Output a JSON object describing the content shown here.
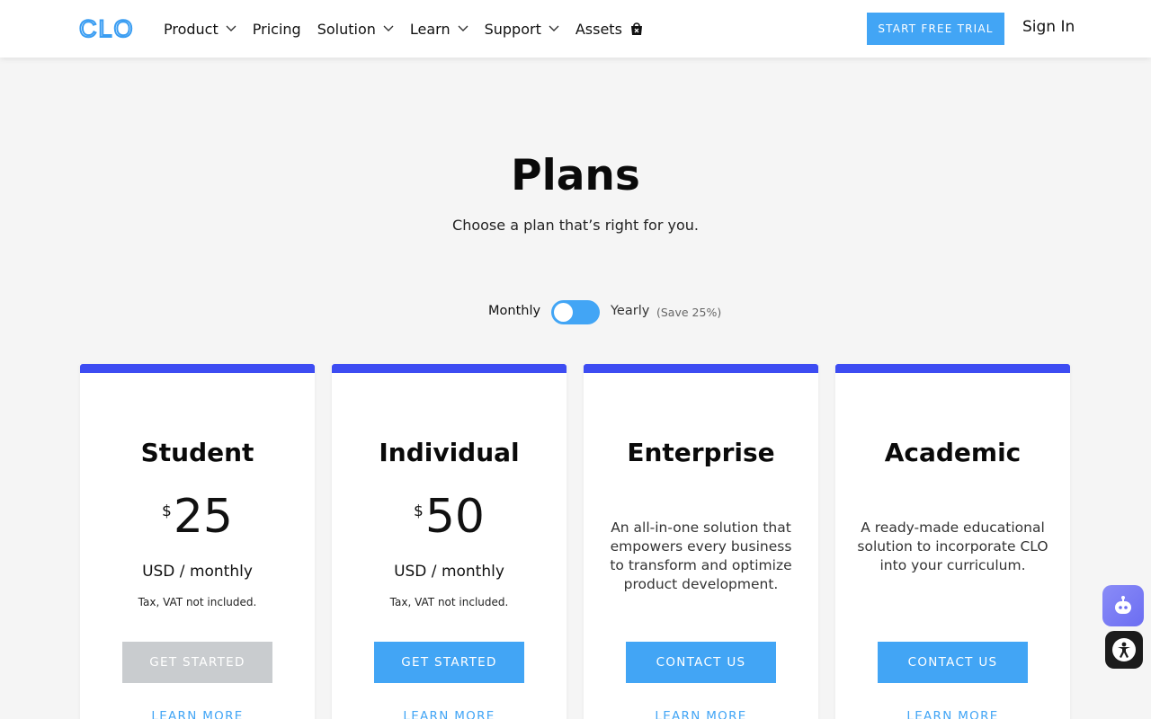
{
  "header": {
    "logo": "CLO",
    "nav": [
      {
        "label": "Product",
        "icon": "chevron-down-icon"
      },
      {
        "label": "Pricing"
      },
      {
        "label": "Solution",
        "icon": "chevron-down-icon"
      },
      {
        "label": "Learn",
        "icon": "chevron-down-icon"
      },
      {
        "label": "Support",
        "icon": "chevron-down-icon"
      },
      {
        "label": "Assets",
        "icon": "shopping-bag-icon"
      }
    ],
    "trial_button": "START FREE TRIAL",
    "sign_in": "Sign In"
  },
  "hero": {
    "title": "Plans",
    "subtitle": "Choose a plan that’s right for you."
  },
  "billing_toggle": {
    "monthly_label": "Monthly",
    "yearly_label": "Yearly",
    "save_label": "(Save 25%)",
    "selected": "Monthly"
  },
  "plans": [
    {
      "name": "Student",
      "currency": "$",
      "price": "25",
      "unit": "USD / monthly",
      "tax": "Tax, VAT not included.",
      "cta": "GET STARTED",
      "cta_disabled": true,
      "learn_more": "LEARN MORE"
    },
    {
      "name": "Individual",
      "currency": "$",
      "price": "50",
      "unit": "USD / monthly",
      "tax": "Tax, VAT not included.",
      "cta": "GET STARTED",
      "cta_disabled": false,
      "learn_more": "LEARN MORE"
    },
    {
      "name": "Enterprise",
      "description": "An all-in-one solution that empowers every business to transform and optimize product development.",
      "cta": "CONTACT US",
      "learn_more": "LEARN MORE"
    },
    {
      "name": "Academic",
      "description": "A ready-made educational solution to incorporate CLO into your curriculum.",
      "cta": "CONTACT US",
      "learn_more": "LEARN MORE"
    }
  ],
  "colors": {
    "accent": "#42a5f5",
    "card_bar": "#3d4cf2",
    "disabled": "#c9cccf"
  },
  "floating": {
    "chatbot_icon": "chatbot-icon",
    "accessibility_icon": "accessibility-icon"
  }
}
